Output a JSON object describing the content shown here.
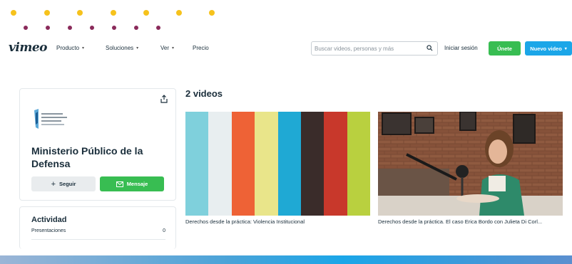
{
  "nav": {
    "logo": "vimeo",
    "links": [
      {
        "label": "Producto",
        "has_dropdown": true
      },
      {
        "label": "Soluciones",
        "has_dropdown": true
      },
      {
        "label": "Ver",
        "has_dropdown": true
      },
      {
        "label": "Precio",
        "has_dropdown": false
      }
    ],
    "search_placeholder": "Buscar videos, personas y más",
    "login": "Iniciar sesión",
    "join": "Únete",
    "new_video": "Nuevo video"
  },
  "profile": {
    "name": "Ministerio Público de la Defensa",
    "follow": "Seguir",
    "message": "Mensaje"
  },
  "activity": {
    "title": "Actividad",
    "rows": [
      {
        "label": "Presentaciones",
        "value": "0"
      }
    ]
  },
  "videos": {
    "title": "2 videos",
    "items": [
      {
        "title": "Derechos desde la práctica: Violencia Institucional"
      },
      {
        "title": "Derechos desde la práctica. El caso Erica Bordo con Julieta Di Corl..."
      }
    ],
    "thumb_colors": [
      "#7fd0dc",
      "#e8eef0",
      "#ee6236",
      "#e9e58a",
      "#1fa9d4",
      "#3a2c2a",
      "#c8382b",
      "#b9d03f"
    ]
  },
  "colors": {
    "accent_green": "#38bd52",
    "accent_blue": "#1ba6e8",
    "dot_yellow": "#f6c21c",
    "dot_purple": "#8a2a5a"
  }
}
